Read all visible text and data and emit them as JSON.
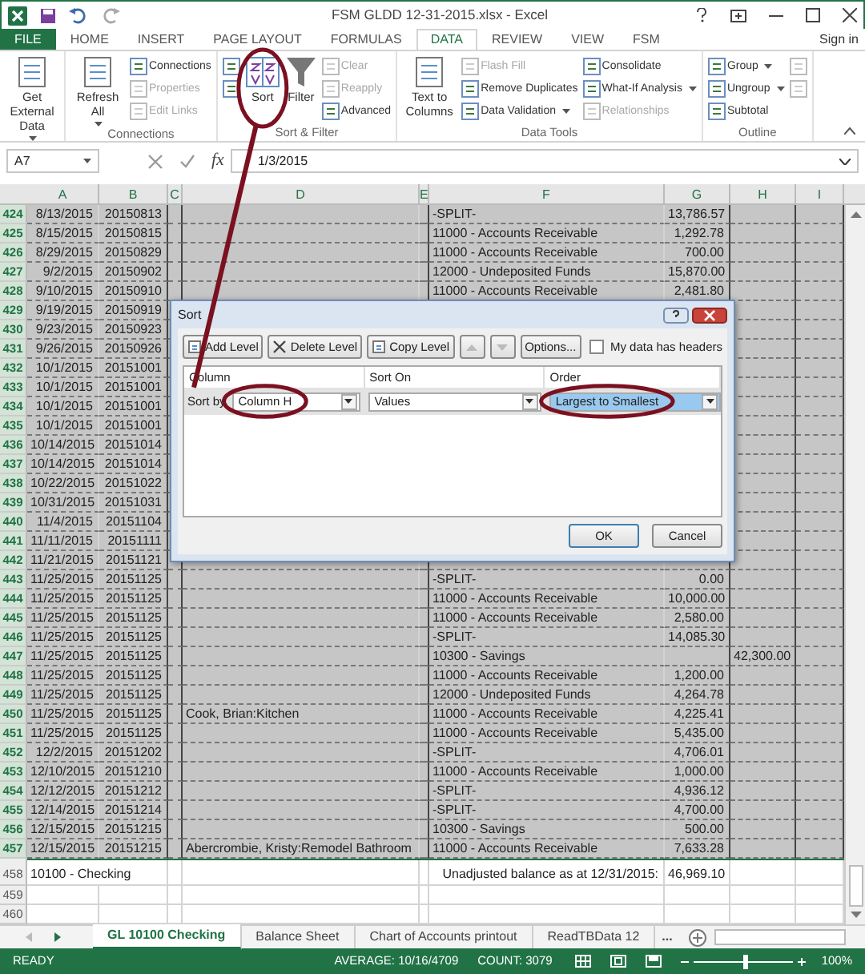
{
  "title_bar": {
    "title": "FSM GLDD 12-31-2015.xlsx - Excel",
    "sign_in": "Sign in"
  },
  "ribbon_tabs": [
    {
      "label": "FILE",
      "kind": "file",
      "selected": false
    },
    {
      "label": "HOME",
      "kind": "tab",
      "selected": false
    },
    {
      "label": "INSERT",
      "kind": "tab",
      "selected": false
    },
    {
      "label": "PAGE LAYOUT",
      "kind": "tab",
      "selected": false
    },
    {
      "label": "FORMULAS",
      "kind": "tab",
      "selected": false
    },
    {
      "label": "DATA",
      "kind": "tab",
      "selected": true
    },
    {
      "label": "REVIEW",
      "kind": "tab",
      "selected": false
    },
    {
      "label": "VIEW",
      "kind": "tab",
      "selected": false
    },
    {
      "label": "FSM",
      "kind": "tab",
      "selected": false
    }
  ],
  "ribbon_groups": [
    {
      "columns": [
        {
          "kind": "large",
          "items": [
            {
              "label": "Get External Data",
              "dropdown": true,
              "disabled": false
            }
          ]
        }
      ]
    },
    {
      "label": "Connections",
      "columns": [
        {
          "kind": "large",
          "items": [
            {
              "label": "Refresh All",
              "dropdown": true,
              "disabled": false
            }
          ]
        },
        {
          "kind": "stack",
          "items": [
            {
              "label": "Connections",
              "disabled": false
            },
            {
              "label": "Properties",
              "disabled": true
            },
            {
              "label": "Edit Links",
              "disabled": true
            }
          ]
        }
      ]
    },
    {
      "label": "Sort & Filter",
      "columns": [
        {
          "kind": "stack",
          "items": [
            {
              "disabled": false
            },
            {
              "disabled": false
            }
          ]
        },
        {
          "kind": "large",
          "items": [
            {
              "label": "Sort",
              "disabled": false
            }
          ]
        },
        {
          "kind": "large",
          "items": [
            {
              "label": "Filter",
              "disabled": false
            }
          ]
        },
        {
          "kind": "stack",
          "items": [
            {
              "label": "Clear",
              "disabled": true
            },
            {
              "label": "Reapply",
              "disabled": true
            },
            {
              "label": "Advanced",
              "disabled": false
            }
          ]
        }
      ]
    },
    {
      "label": "Data Tools",
      "columns": [
        {
          "kind": "large",
          "items": [
            {
              "label": "Text to Columns",
              "disabled": false
            }
          ]
        },
        {
          "kind": "stack",
          "items": [
            {
              "label": "Flash Fill",
              "disabled": true
            },
            {
              "label": "Remove Duplicates",
              "disabled": false
            },
            {
              "label": "Data Validation",
              "dropdown": true,
              "disabled": false
            }
          ]
        },
        {
          "kind": "stack",
          "items": [
            {
              "label": "Consolidate",
              "disabled": false
            },
            {
              "label": "What-If Analysis",
              "dropdown": true,
              "disabled": false
            },
            {
              "label": "Relationships",
              "disabled": true
            }
          ]
        }
      ]
    },
    {
      "label": "Outline",
      "columns": [
        {
          "kind": "stack",
          "items": [
            {
              "label": "Group",
              "dropdown": true,
              "disabled": false
            },
            {
              "label": "Ungroup",
              "dropdown": true,
              "disabled": false
            },
            {
              "label": "Subtotal",
              "disabled": false
            }
          ]
        },
        {
          "kind": "stack",
          "items": [
            {
              "disabled": true
            },
            {
              "disabled": true
            }
          ]
        }
      ]
    }
  ],
  "formula_bar": {
    "name_box": "A7",
    "function_label": "fx",
    "formula": "1/3/2015"
  },
  "columns": [
    "A",
    "B",
    "C",
    "D",
    "E",
    "F",
    "G",
    "H",
    "I"
  ],
  "rows": [
    {
      "num": "424",
      "selected": true,
      "A": "8/13/2015",
      "B": "20150813",
      "F": "-SPLIT-",
      "G": "13,786.57"
    },
    {
      "num": "425",
      "selected": true,
      "A": "8/15/2015",
      "B": "20150815",
      "F": "11000 - Accounts Receivable",
      "G": "1,292.78"
    },
    {
      "num": "426",
      "selected": true,
      "A": "8/29/2015",
      "B": "20150829",
      "F": "11000 - Accounts Receivable",
      "G": "700.00"
    },
    {
      "num": "427",
      "selected": true,
      "A": "9/2/2015",
      "B": "20150902",
      "F": "12000 - Undeposited Funds",
      "G": "15,870.00"
    },
    {
      "num": "428",
      "selected": true,
      "A": "9/10/2015",
      "B": "20150910",
      "F": "11000 - Accounts Receivable",
      "G": "2,481.80"
    },
    {
      "num": "429",
      "selected": true,
      "A": "9/19/2015",
      "B": "20150919"
    },
    {
      "num": "430",
      "selected": true,
      "A": "9/23/2015",
      "B": "20150923"
    },
    {
      "num": "431",
      "selected": true,
      "A": "9/26/2015",
      "B": "20150926"
    },
    {
      "num": "432",
      "selected": true,
      "A": "10/1/2015",
      "B": "20151001"
    },
    {
      "num": "433",
      "selected": true,
      "A": "10/1/2015",
      "B": "20151001"
    },
    {
      "num": "434",
      "selected": true,
      "A": "10/1/2015",
      "B": "20151001"
    },
    {
      "num": "435",
      "selected": true,
      "A": "10/1/2015",
      "B": "20151001"
    },
    {
      "num": "436",
      "selected": true,
      "A": "10/14/2015",
      "B": "20151014"
    },
    {
      "num": "437",
      "selected": true,
      "A": "10/14/2015",
      "B": "20151014"
    },
    {
      "num": "438",
      "selected": true,
      "A": "10/22/2015",
      "B": "20151022"
    },
    {
      "num": "439",
      "selected": true,
      "A": "10/31/2015",
      "B": "20151031"
    },
    {
      "num": "440",
      "selected": true,
      "A": "11/4/2015",
      "B": "20151104"
    },
    {
      "num": "441",
      "selected": true,
      "A": "11/11/2015",
      "B": "20151111"
    },
    {
      "num": "442",
      "selected": true,
      "A": "11/21/2015",
      "B": "20151121"
    },
    {
      "num": "443",
      "selected": true,
      "A": "11/25/2015",
      "B": "20151125",
      "F": "-SPLIT-",
      "G": "0.00"
    },
    {
      "num": "444",
      "selected": true,
      "A": "11/25/2015",
      "B": "20151125",
      "F": "11000 - Accounts Receivable",
      "G": "10,000.00"
    },
    {
      "num": "445",
      "selected": true,
      "A": "11/25/2015",
      "B": "20151125",
      "F": "11000 - Accounts Receivable",
      "G": "2,580.00"
    },
    {
      "num": "446",
      "selected": true,
      "A": "11/25/2015",
      "B": "20151125",
      "F": "-SPLIT-",
      "G": "14,085.30"
    },
    {
      "num": "447",
      "selected": true,
      "A": "11/25/2015",
      "B": "20151125",
      "F": "10300 - Savings",
      "H": "42,300.00"
    },
    {
      "num": "448",
      "selected": true,
      "A": "11/25/2015",
      "B": "20151125",
      "F": "11000 - Accounts Receivable",
      "G": "1,200.00"
    },
    {
      "num": "449",
      "selected": true,
      "A": "11/25/2015",
      "B": "20151125",
      "F": "12000 - Undeposited Funds",
      "G": "4,264.78"
    },
    {
      "num": "450",
      "selected": true,
      "A": "11/25/2015",
      "B": "20151125",
      "D": "Cook, Brian:Kitchen",
      "F": "11000 - Accounts Receivable",
      "G": "4,225.41"
    },
    {
      "num": "451",
      "selected": true,
      "A": "11/25/2015",
      "B": "20151125",
      "F": "11000 - Accounts Receivable",
      "G": "5,435.00"
    },
    {
      "num": "452",
      "selected": true,
      "A": "12/2/2015",
      "B": "20151202",
      "F": "-SPLIT-",
      "G": "4,706.01"
    },
    {
      "num": "453",
      "selected": true,
      "A": "12/10/2015",
      "B": "20151210",
      "F": "11000 - Accounts Receivable",
      "G": "1,000.00"
    },
    {
      "num": "454",
      "selected": true,
      "A": "12/12/2015",
      "B": "20151212",
      "F": "-SPLIT-",
      "G": "4,936.12"
    },
    {
      "num": "455",
      "selected": true,
      "A": "12/14/2015",
      "B": "20151214",
      "F": "-SPLIT-",
      "G": "4,700.00"
    },
    {
      "num": "456",
      "selected": true,
      "A": "12/15/2015",
      "B": "20151215",
      "F": "10300 - Savings",
      "G": "500.00"
    },
    {
      "num": "457",
      "selected": true,
      "A": "12/15/2015",
      "B": "20151215",
      "D": "Abercrombie, Kristy:Remodel Bathroom",
      "F": "11000 - Accounts Receivable",
      "G": "7,633.28"
    },
    {
      "num": "458",
      "selected": false,
      "A": "10100 - Checking",
      "F": "Unadjusted balance as at 12/31/2015:",
      "G": "46,969.10"
    },
    {
      "num": "459",
      "selected": false
    },
    {
      "num": "460",
      "selected": false
    }
  ],
  "sort_dialog": {
    "title": "Sort",
    "toolbar": [
      {
        "label": "Add Level",
        "kind": "button"
      },
      {
        "label": "Delete Level",
        "kind": "button"
      },
      {
        "label": "Copy Level",
        "kind": "button"
      },
      {
        "kind": "move_up"
      },
      {
        "kind": "move_down"
      },
      {
        "label": "Options...",
        "kind": "button"
      }
    ],
    "headers_checkbox": {
      "label": "My data has headers",
      "checked": false
    },
    "headers": [
      "Column",
      "Sort On",
      "Order"
    ],
    "levels": [
      {
        "label": "Sort by",
        "column": "Column H",
        "sort_on": "Values",
        "order": "Largest to Smallest",
        "selected": true
      }
    ],
    "buttons": [
      "OK",
      "Cancel"
    ]
  },
  "sheet_tabs": [
    {
      "label": "GL 10100 Checking",
      "selected": true
    },
    {
      "label": "Balance Sheet",
      "selected": false
    },
    {
      "label": "Chart of Accounts printout",
      "selected": false
    },
    {
      "label": "ReadTBData 12",
      "selected": false
    }
  ],
  "sheet_tabs_more": "...",
  "status_bar": {
    "mode": "READY",
    "average": "AVERAGE: 10/16/4709",
    "count": "COUNT: 3079",
    "zoom": "100%",
    "zoom_level": {
      "level": 0.5
    }
  }
}
